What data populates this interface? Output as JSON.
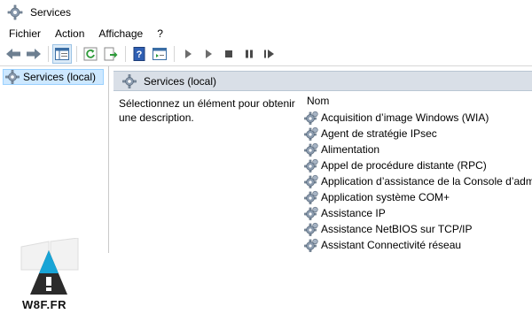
{
  "window": {
    "title": "Services"
  },
  "menu": [
    {
      "label": "Fichier"
    },
    {
      "label": "Action"
    },
    {
      "label": "Affichage"
    },
    {
      "label": "?"
    }
  ],
  "tree": {
    "selected_label": "Services (local)"
  },
  "content": {
    "header_label": "Services (local)",
    "description": "Sélectionnez un élément pour obtenir une description.",
    "column_name": "Nom",
    "services": [
      "Acquisition d’image Windows (WIA)",
      "Agent de stratégie IPsec",
      "Alimentation",
      "Appel de procédure distante (RPC)",
      "Application d’assistance de la Console d’administration",
      "Application système COM+",
      "Assistance IP",
      "Assistance NetBIOS sur TCP/IP",
      "Assistant Connectivité réseau"
    ]
  },
  "watermark": {
    "text": "W8F.FR"
  },
  "colors": {
    "selection_bg": "#cde8ff",
    "header_band": "#d9dfe7",
    "arrow_blue": "#1e73be",
    "play_gray": "#6d6d6d"
  }
}
